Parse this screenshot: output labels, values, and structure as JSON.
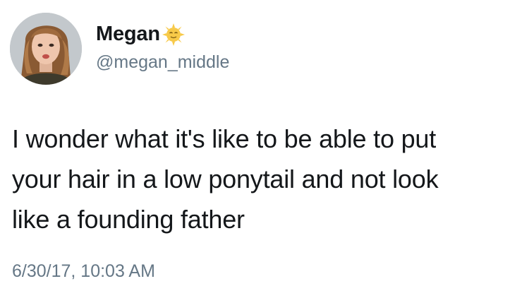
{
  "tweet": {
    "author": {
      "display_name": "Megan",
      "handle": "@megan_middle",
      "name_emoji": "sun-face-icon"
    },
    "text_lines": [
      "I wonder what it's like to be able to put",
      "your hair in a low ponytail and not look",
      "like a founding father"
    ],
    "timestamp": "6/30/17, 10:03 AM"
  },
  "colors": {
    "text": "#14171a",
    "secondary": "#657786",
    "background": "#ffffff",
    "emoji_face": "#f7c948"
  }
}
